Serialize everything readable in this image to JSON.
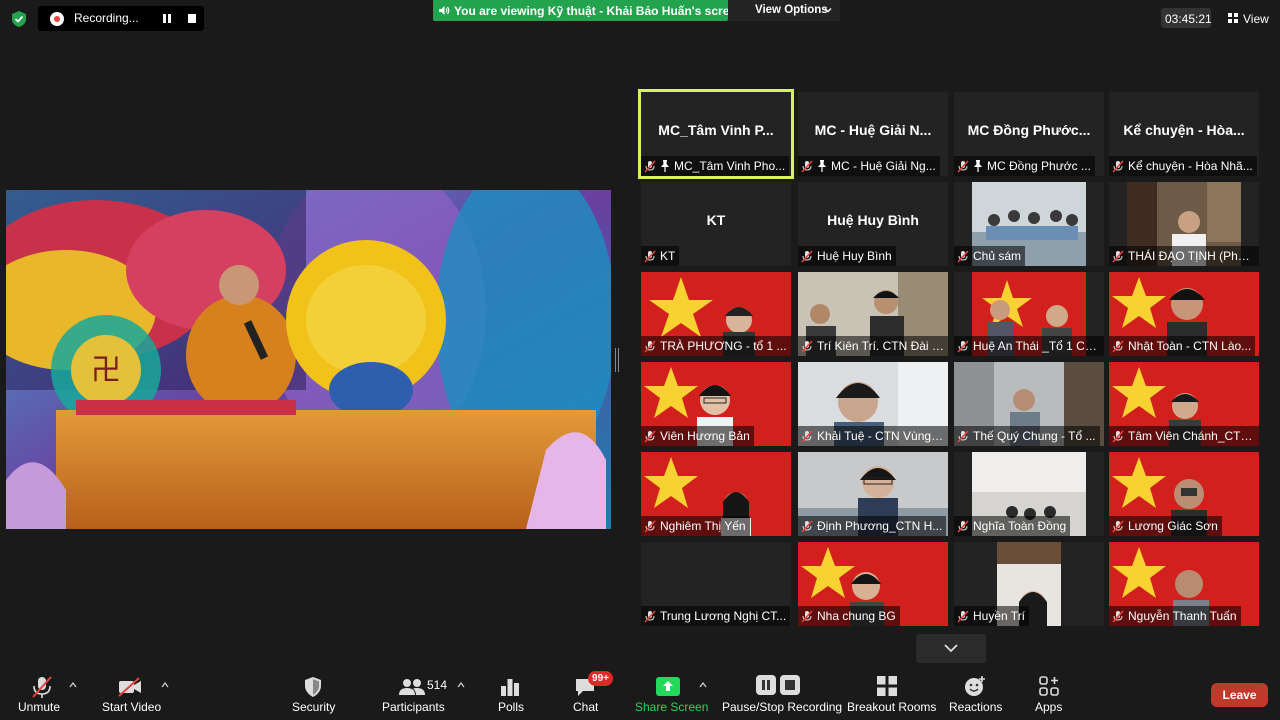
{
  "topbar": {
    "recording_label": "Recording...",
    "viewing_banner": "You are viewing Kỹ thuật - Khải Bảo Huấn's screen",
    "view_options_label": "View Options",
    "timer": "03:45:21",
    "view_label": "View"
  },
  "participants": [
    {
      "big": "MC_Tâm Vinh P...",
      "label": "MC_Tâm Vinh Pho...",
      "pinned": true
    },
    {
      "big": "MC - Huệ Giải N...",
      "label": "MC - Huệ Giải Ng...",
      "pinned": true
    },
    {
      "big": "MC Đồng Phước...",
      "label": "MC Đồng Phước ...",
      "pinned": true
    },
    {
      "big": "Kể chuyện - Hòa...",
      "label": "Kể chuyện - Hòa Nhã..."
    },
    {
      "big": "KT",
      "label": "KT"
    },
    {
      "big": "Huệ Huy Bình",
      "label": "Huệ Huy Bình"
    },
    {
      "label": "Chủ sám"
    },
    {
      "label": "THÁI ĐẠO TỊNH (Phật..."
    },
    {
      "label": "TRÀ PHƯƠNG - tổ 1 ..."
    },
    {
      "label": "Trí Kiên Trí. CTN Đài L..."
    },
    {
      "label": "Huệ An Thái _Tổ 1 CT..."
    },
    {
      "label": "Nhật Toàn - CTN Lào..."
    },
    {
      "label": "Viên Hương Bản"
    },
    {
      "label": "Khải Tuệ - CTN Vùng ..."
    },
    {
      "label": "Thế Quý Chung - Tổ ..."
    },
    {
      "label": "Tâm Viên Chánh_CTN..."
    },
    {
      "label": "Nghiêm Thị Yến"
    },
    {
      "label": "Định Phương_CTN H..."
    },
    {
      "label": "Nghĩa Toàn Đồng"
    },
    {
      "label": "Lương Giác Sơn"
    },
    {
      "label": "Trung Lương Nghị CT..."
    },
    {
      "label": "Nha chung BG"
    },
    {
      "label": "Huyền Trí"
    },
    {
      "label": "Nguyễn Thanh Tuấn"
    }
  ],
  "toolbar": {
    "unmute": "Unmute",
    "start_video": "Start Video",
    "security": "Security",
    "participants": "Participants",
    "participants_count": "514",
    "polls": "Polls",
    "chat": "Chat",
    "chat_badge": "99+",
    "share_screen": "Share Screen",
    "pause_stop_recording": "Pause/Stop Recording",
    "breakout_rooms": "Breakout Rooms",
    "reactions": "Reactions",
    "apps": "Apps",
    "leave": "Leave"
  },
  "colors": {
    "background": "#1a1a1a",
    "banner_green": "#23a34e",
    "active_speaker": "#d6f25c",
    "leave_red": "#c0392b",
    "share_green": "#23d959",
    "badge_red": "#e02828"
  }
}
